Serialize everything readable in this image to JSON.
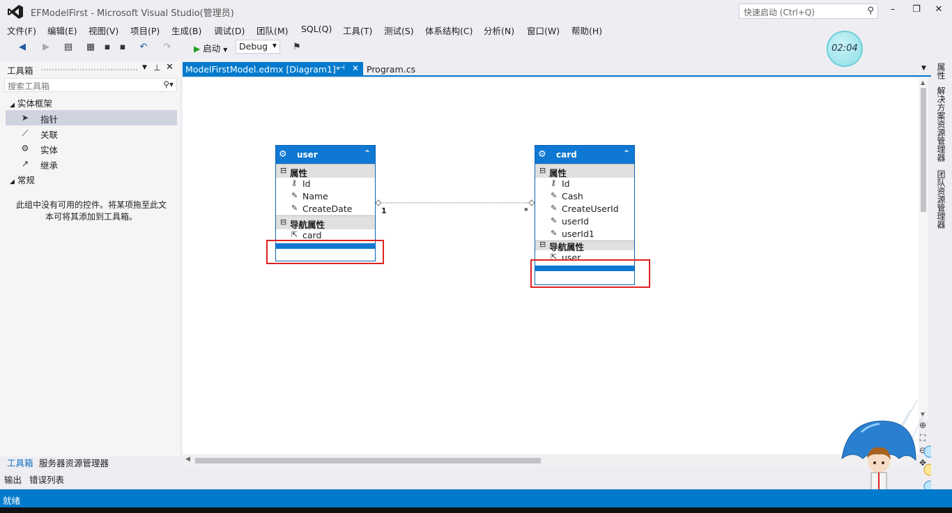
{
  "window": {
    "title": "EFModelFirst - Microsoft Visual Studio(管理员)",
    "quick_launch_placeholder": "快速启动 (Ctrl+Q)",
    "minimize": "–",
    "restore": "❐",
    "close": "✕"
  },
  "menu": [
    "文件(F)",
    "编辑(E)",
    "视图(V)",
    "项目(P)",
    "生成(B)",
    "调试(D)",
    "团队(M)",
    "SQL(Q)",
    "工具(T)",
    "测试(S)",
    "体系结构(C)",
    "分析(N)",
    "窗口(W)",
    "帮助(H)"
  ],
  "toolbar": {
    "start_label": "启动",
    "config": "Debug"
  },
  "timer": "02:04",
  "toolbox": {
    "title": "工具箱",
    "search_placeholder": "搜索工具箱",
    "groups": [
      {
        "label": "实体框架"
      },
      {
        "label": "常规"
      }
    ],
    "items": [
      {
        "label": "指针",
        "icon": "pointer-icon"
      },
      {
        "label": "关联",
        "icon": "association-icon"
      },
      {
        "label": "实体",
        "icon": "entity-icon"
      },
      {
        "label": "继承",
        "icon": "inheritance-icon"
      }
    ],
    "empty_message": "此组中没有可用的控件。将某项拖至此文本可将其添加到工具箱。"
  },
  "panel_tabs": [
    "工具箱",
    "服务器资源管理器"
  ],
  "output_tabs": [
    "输出",
    "错误列表"
  ],
  "doc_tabs": {
    "active": "ModelFirstModel.edmx [Diagram1]*",
    "other": "Program.cs"
  },
  "side_tabs": [
    "属性",
    "解决方案资源管理器",
    "团队资源管理器"
  ],
  "entities": [
    {
      "name": "user",
      "properties_label": "属性",
      "properties": [
        "Id",
        "Name",
        "CreateDate"
      ],
      "nav_label": "导航属性",
      "nav_properties": [
        "card"
      ]
    },
    {
      "name": "card",
      "properties_label": "属性",
      "properties": [
        "Id",
        "Cash",
        "CreateUserId",
        "userId",
        "userId1"
      ],
      "nav_label": "导航属性",
      "nav_properties": [
        "user"
      ]
    }
  ],
  "association": {
    "left_multiplicity": "1",
    "right_multiplicity": "*"
  },
  "status": "就绪",
  "colors": {
    "accent": "#007acc",
    "entity_header": "#0f78d2",
    "highlight_box": "#e02020"
  }
}
